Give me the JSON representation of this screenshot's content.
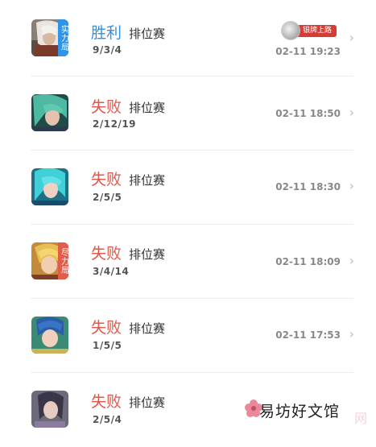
{
  "matches": [
    {
      "result": "胜利",
      "outcome": "win",
      "mode": "排位赛",
      "kda": "9/3/4",
      "time": "02-11 19:23",
      "badge": "实力局",
      "badge_type": "mvp",
      "rank_label": "银牌上路",
      "hero": "white-haired-hero-icon"
    },
    {
      "result": "失败",
      "outcome": "lose",
      "mode": "排位赛",
      "kda": "2/12/19",
      "time": "02-11 18:50",
      "badge": "",
      "hero": "teal-haired-hero-icon"
    },
    {
      "result": "失败",
      "outcome": "lose",
      "mode": "排位赛",
      "kda": "2/5/5",
      "time": "02-11 18:30",
      "badge": "",
      "hero": "aqua-haired-hero-icon"
    },
    {
      "result": "失败",
      "outcome": "lose",
      "mode": "排位赛",
      "kda": "3/4/14",
      "time": "02-11 18:09",
      "badge": "尽力局",
      "badge_type": "svp",
      "hero": "blonde-hero-icon"
    },
    {
      "result": "失败",
      "outcome": "lose",
      "mode": "排位赛",
      "kda": "1/5/5",
      "time": "02-11 17:53",
      "badge": "",
      "hero": "blue-haired-hero-icon"
    },
    {
      "result": "失败",
      "outcome": "lose",
      "mode": "排位赛",
      "kda": "2/5/4",
      "time": "",
      "badge": "",
      "hero": "dark-haired-hero-icon"
    }
  ],
  "watermark": {
    "text": "易坊好文馆",
    "faded": "网"
  },
  "colors": {
    "win": "#2f8fe5",
    "lose": "#e45548",
    "mvp_badge": "#2f93e8",
    "svp_badge": "#e35c4b",
    "rank_ribbon": "#d83a34"
  }
}
